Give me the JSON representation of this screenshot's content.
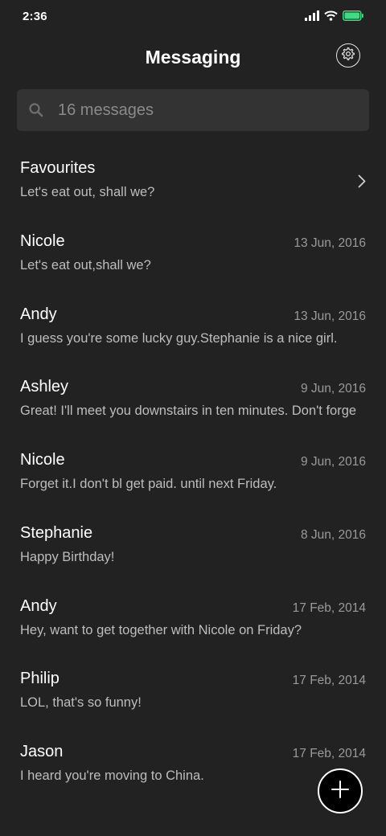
{
  "status_bar": {
    "time": "2:36",
    "battery_color": "#3ddc84"
  },
  "header": {
    "title": "Messaging",
    "settings_icon": "gear-icon"
  },
  "search": {
    "placeholder": "16 messages",
    "icon": "search-icon"
  },
  "conversations": [
    {
      "name": "Favourites",
      "snippet": "Let's eat out, shall we?",
      "date": "",
      "has_chevron": true
    },
    {
      "name": "Nicole",
      "snippet": "Let's eat out,shall we?",
      "date": "13 Jun, 2016"
    },
    {
      "name": "Andy",
      "snippet": "I guess you're some lucky guy.Stephanie is a nice girl.",
      "date": "13 Jun, 2016"
    },
    {
      "name": "Ashley",
      "snippet": "Great! I'll meet you downstairs in ten minutes. Don't forge",
      "date": "9 Jun, 2016"
    },
    {
      "name": "Nicole",
      "snippet": "Forget it.I don't bl get paid. until next Friday.",
      "date": "9 Jun, 2016"
    },
    {
      "name": "Stephanie",
      "snippet": "Happy Birthday!",
      "date": "8 Jun, 2016"
    },
    {
      "name": "Andy",
      "snippet": "Hey, want to get together with Nicole on Friday?",
      "date": "17 Feb, 2014"
    },
    {
      "name": "Philip",
      "snippet": "LOL, that's so funny!",
      "date": "17 Feb, 2014"
    },
    {
      "name": "Jason",
      "snippet": "I heard you're moving to China.",
      "date": "17 Feb, 2014"
    }
  ],
  "fab": {
    "icon": "plus-icon"
  }
}
